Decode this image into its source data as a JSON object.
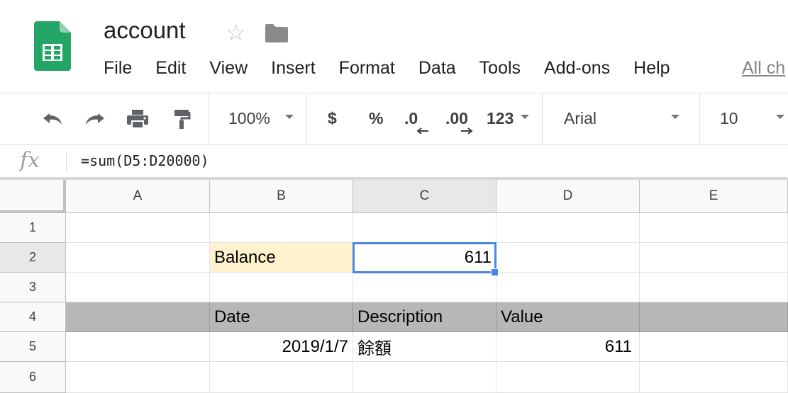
{
  "doc": {
    "title": "account",
    "star_glyph": "☆",
    "status": "All ch"
  },
  "menu": [
    "File",
    "Edit",
    "View",
    "Insert",
    "Format",
    "Data",
    "Tools",
    "Add-ons",
    "Help"
  ],
  "toolbar": {
    "zoom": "100%",
    "currency": "$",
    "percent": "%",
    "decrease_decimal": ".0",
    "increase_decimal": ".00",
    "number_format": "123",
    "font": "Arial",
    "font_size": "10"
  },
  "formula": {
    "fx": "fx",
    "value": "=sum(D5:D20000)"
  },
  "grid": {
    "columns": [
      "A",
      "B",
      "C",
      "D",
      "E"
    ],
    "rows": [
      "1",
      "2",
      "3",
      "4",
      "5",
      "6"
    ],
    "cells": {
      "B2": "Balance",
      "C2": "611",
      "B4": "Date",
      "C4": "Description",
      "D4": "Value",
      "B5": "2019/1/7",
      "C5": "餘額",
      "D5": "611"
    }
  },
  "colors": {
    "brand_green": "#0f9d58",
    "selection_blue": "#4a86e8",
    "header_row_gray": "#b7b7b7",
    "balance_yellow": "#fff2cc"
  }
}
